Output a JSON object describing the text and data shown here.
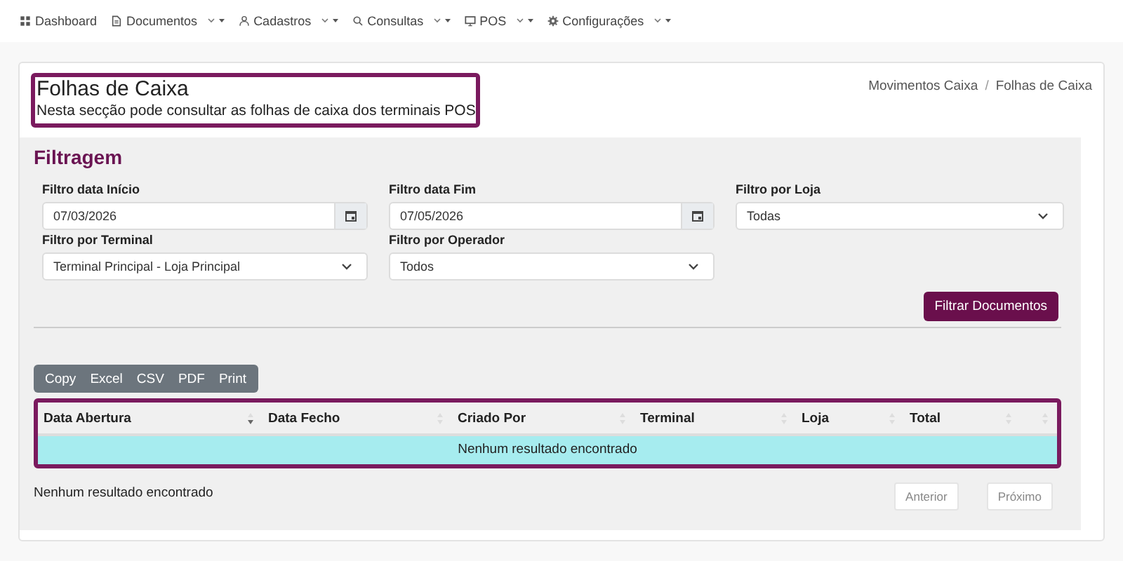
{
  "navbar": {
    "items": [
      {
        "label": "Dashboard",
        "dropdown": false
      },
      {
        "label": "Documentos",
        "dropdown": true
      },
      {
        "label": "Cadastros",
        "dropdown": true
      },
      {
        "label": "Consultas",
        "dropdown": true
      },
      {
        "label": "POS",
        "dropdown": true
      },
      {
        "label": "Configurações",
        "dropdown": true
      }
    ]
  },
  "header": {
    "title": "Folhas de Caixa",
    "subtitle": "Nesta secção pode consultar as folhas de caixa dos terminais POS",
    "highlighted": true
  },
  "breadcrumb": {
    "items": [
      "Movimentos Caixa",
      "Folhas de Caixa"
    ],
    "separator": "/"
  },
  "filter": {
    "title": "Filtragem",
    "fields": [
      {
        "label": "Filtro data Início",
        "kind": "date",
        "value": "07/03/2026"
      },
      {
        "label": "Filtro data Fim",
        "kind": "date",
        "value": "07/05/2026"
      },
      {
        "label": "Filtro por Loja",
        "kind": "select",
        "value": "Todas"
      },
      {
        "label": "Filtro por Terminal",
        "kind": "select",
        "value": "Terminal Principal - Loja Principal"
      },
      {
        "label": "Filtro por Operador",
        "kind": "select",
        "value": "Todos"
      }
    ],
    "submit": "Filtrar Documentos"
  },
  "export_buttons": [
    "Copy",
    "Excel",
    "CSV",
    "PDF",
    "Print"
  ],
  "table": {
    "highlighted": true,
    "columns": [
      {
        "label": "Data Abertura",
        "sorted": true
      },
      {
        "label": "Data Fecho",
        "sorted": false
      },
      {
        "label": "Criado Por",
        "sorted": false
      },
      {
        "label": "Terminal",
        "sorted": false
      },
      {
        "label": "Loja",
        "sorted": false
      },
      {
        "label": "Total",
        "sorted": false
      },
      {
        "sorted": false
      }
    ],
    "empty_message": "Nenhum resultado encontrado"
  },
  "info": "Nenhum resultado encontrado",
  "pagination": [
    {
      "label": "Anterior",
      "disabled": true
    },
    {
      "label": "Próximo",
      "disabled": true
    }
  ]
}
